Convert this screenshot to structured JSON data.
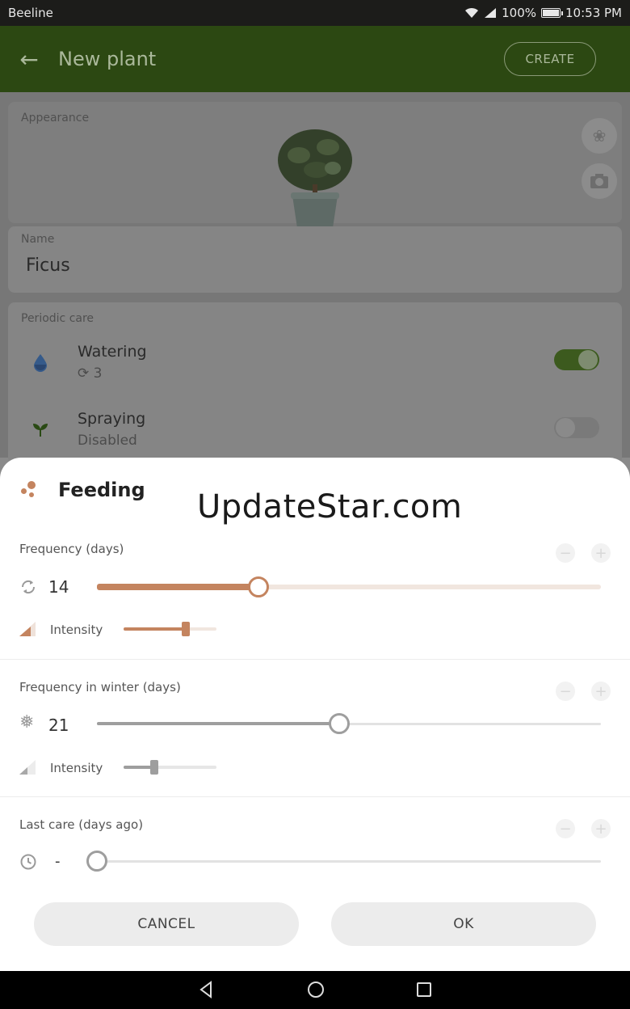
{
  "status_bar": {
    "carrier": "Beeline",
    "battery": "100%",
    "time": "10:53 PM",
    "icons": [
      "wifi-icon",
      "signal-icon",
      "battery-icon"
    ]
  },
  "app_bar": {
    "title": "New plant",
    "create_label": "CREATE",
    "back_icon": "arrow-back-icon"
  },
  "appearance": {
    "label": "Appearance",
    "side_icons": [
      "flower-icon",
      "camera-icon"
    ]
  },
  "name": {
    "label": "Name",
    "value": "Ficus"
  },
  "periodic_care": {
    "label": "Periodic care",
    "items": [
      {
        "title": "Watering",
        "subtitle": "3",
        "icon": "water-drop-icon",
        "enabled": true
      },
      {
        "title": "Spraying",
        "subtitle": "Disabled",
        "icon": "sprout-icon",
        "enabled": false
      }
    ]
  },
  "sheet": {
    "title": "Feeding",
    "accent_color": "#c4845f",
    "watermark": "UpdateStar.com",
    "frequency": {
      "label": "Frequency (days)",
      "value": "14",
      "slider_fraction": 0.32,
      "intensity_label": "Intensity",
      "intensity_fraction": 0.67
    },
    "winter": {
      "label": "Frequency in winter (days)",
      "value": "21",
      "slider_fraction": 0.48,
      "intensity_label": "Intensity",
      "intensity_fraction": 0.33
    },
    "last_care": {
      "label": "Last care (days ago)",
      "value": "-",
      "slider_fraction": 0.0
    },
    "cancel_label": "CANCEL",
    "ok_label": "OK"
  },
  "nav_bar": {
    "icons": [
      "back-triangle-icon",
      "home-circle-icon",
      "recents-square-icon"
    ]
  }
}
